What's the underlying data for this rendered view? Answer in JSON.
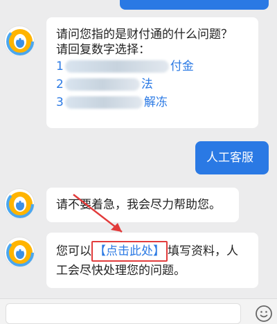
{
  "messages": [
    {
      "type": "incoming",
      "question": "请问您指的是财付通的什么问题？",
      "instruction": "请回复数字选择：",
      "options": [
        {
          "prefix": "1",
          "suffix": "付金"
        },
        {
          "prefix": "2",
          "suffix": "法"
        },
        {
          "prefix": "3",
          "suffix": "解冻"
        }
      ]
    },
    {
      "type": "outgoing",
      "text": "人工客服"
    },
    {
      "type": "incoming",
      "text": "请不要着急，我会尽力帮助您。"
    },
    {
      "type": "incoming",
      "before": "您可以",
      "link": "【点击此处】",
      "after": "填写资料，人工会尽快处理您的问题。"
    }
  ],
  "colors": {
    "accent": "#2a79e4",
    "highlight": "#e23b3b",
    "background": "#ececed"
  },
  "icons": {
    "avatar": "qq-penguin-icon",
    "input_right": "emoji-icon",
    "annotation": "red-arrow-icon"
  }
}
